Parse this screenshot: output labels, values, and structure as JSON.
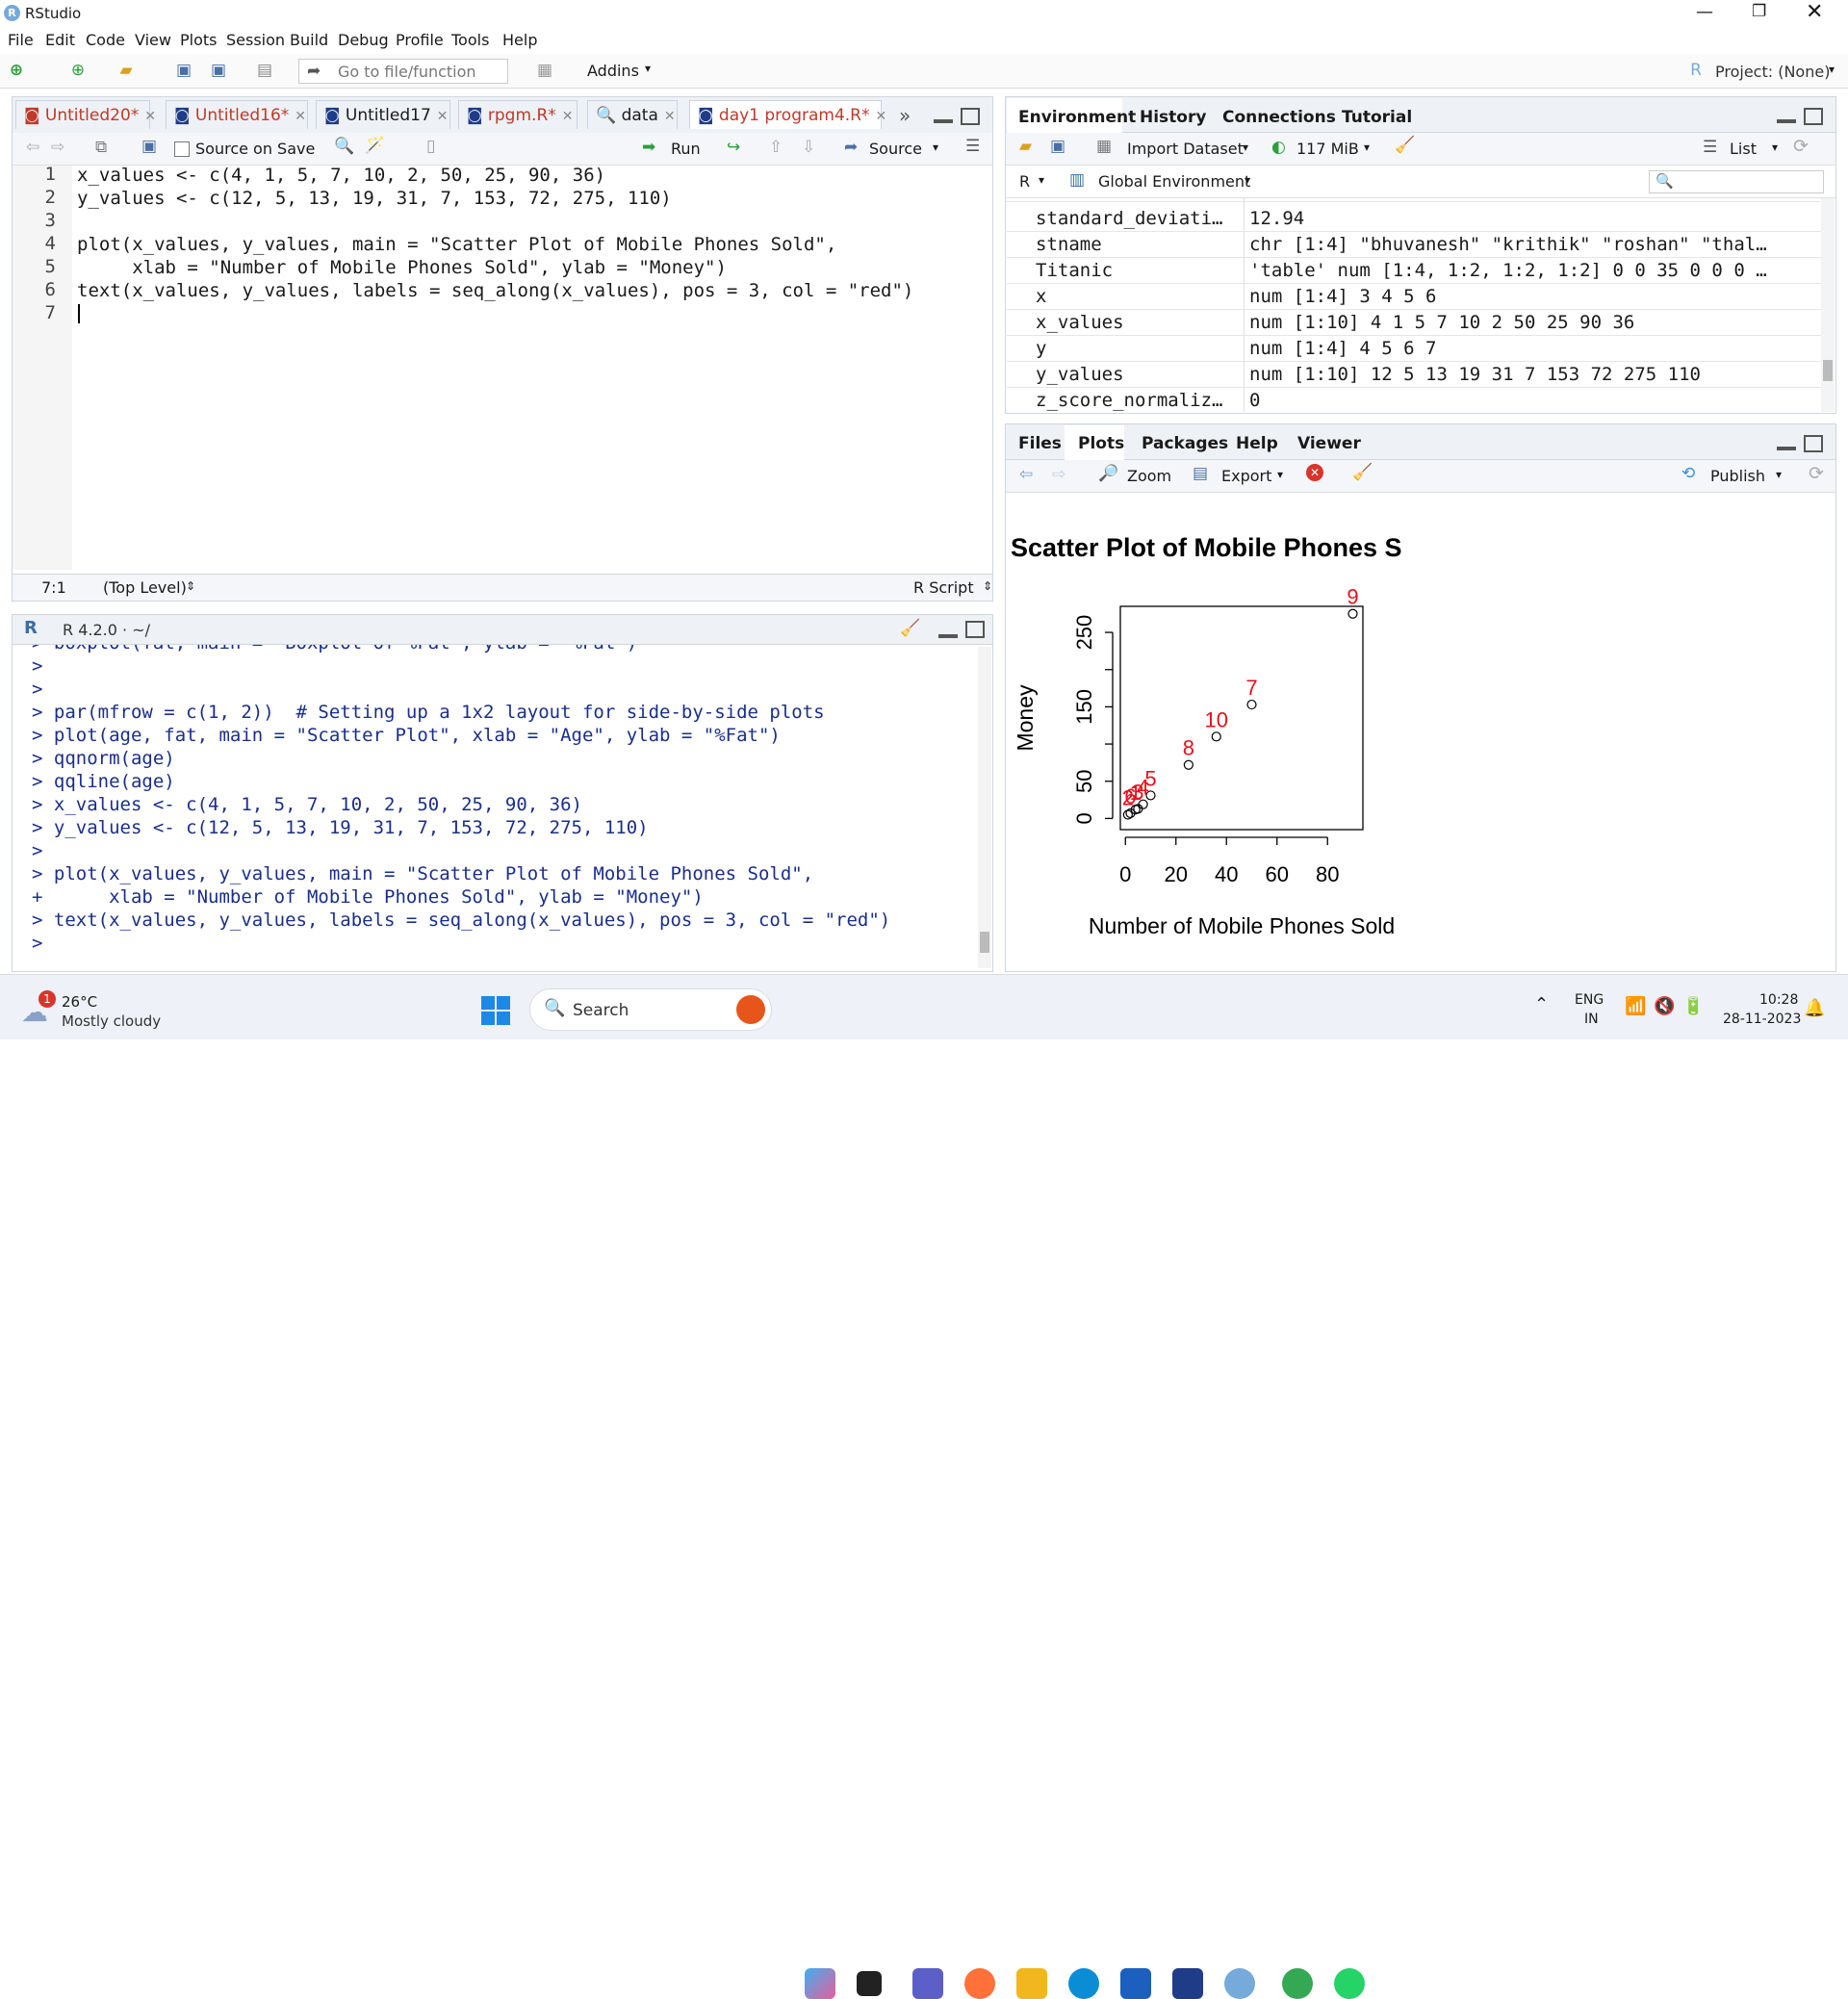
{
  "window": {
    "title": "RStudio",
    "app_icon": "R"
  },
  "menu": [
    "File",
    "Edit",
    "Code",
    "View",
    "Plots",
    "Session",
    "Build",
    "Debug",
    "Profile",
    "Tools",
    "Help"
  ],
  "toolbar": {
    "goto_placeholder": "Go to file/function",
    "addins": "Addins",
    "project": "Project: (None)"
  },
  "editor": {
    "tabs": [
      {
        "label": "Untitled20*",
        "modified": true
      },
      {
        "label": "Untitled16*",
        "modified": true
      },
      {
        "label": "Untitled17",
        "modified": false
      },
      {
        "label": "rpgm.R*",
        "modified": true
      },
      {
        "label": "data",
        "modified": false
      },
      {
        "label": "day1 program4.R*",
        "modified": true
      }
    ],
    "source_on_save": "Source on Save",
    "run": "Run",
    "source": "Source",
    "line_numbers": [
      "1",
      "2",
      "3",
      "4",
      "5",
      "6",
      "7"
    ],
    "lines": [
      "x_values <- c(4, 1, 5, 7, 10, 2, 50, 25, 90, 36)",
      "y_values <- c(12, 5, 13, 19, 31, 7, 153, 72, 275, 110)",
      "",
      "plot(x_values, y_values, main = \"Scatter Plot of Mobile Phones Sold\",",
      "     xlab = \"Number of Mobile Phones Sold\", ylab = \"Money\")",
      "text(x_values, y_values, labels = seq_along(x_values), pos = 3, col = \"red\")",
      ""
    ],
    "status_pos": "7:1",
    "status_scope": "(Top Level)",
    "status_type": "R Script"
  },
  "console": {
    "header": "R 4.2.0 · ~/",
    "lines": [
      "> boxplot(fat, main = \"Boxplot of %Fat\", ylab = \"%Fat\")",
      ">",
      ">",
      "> par(mfrow = c(1, 2))  # Setting up a 1x2 layout for side-by-side plots",
      "> plot(age, fat, main = \"Scatter Plot\", xlab = \"Age\", ylab = \"%Fat\")",
      "> qqnorm(age)",
      "> qqline(age)",
      "> x_values <- c(4, 1, 5, 7, 10, 2, 50, 25, 90, 36)",
      "> y_values <- c(12, 5, 13, 19, 31, 7, 153, 72, 275, 110)",
      ">",
      "> plot(x_values, y_values, main = \"Scatter Plot of Mobile Phones Sold\",",
      "+      xlab = \"Number of Mobile Phones Sold\", ylab = \"Money\")",
      "> text(x_values, y_values, labels = seq_along(x_values), pos = 3, col = \"red\")",
      "> "
    ]
  },
  "environment": {
    "tabs": [
      "Environment",
      "History",
      "Connections",
      "Tutorial"
    ],
    "import_dataset": "Import Dataset",
    "memory": "117 MiB",
    "list": "List",
    "lang": "R",
    "scope": "Global Environment",
    "rows": [
      {
        "name": "standard_deviati…",
        "value": "12.94"
      },
      {
        "name": "stname",
        "value": "chr [1:4] \"bhuvanesh\" \"krithik\" \"roshan\" \"thal…"
      },
      {
        "name": "Titanic",
        "value": "'table' num [1:4, 1:2, 1:2, 1:2] 0 0 35 0 0 0 …"
      },
      {
        "name": "x",
        "value": "num [1:4] 3 4 5 6"
      },
      {
        "name": "x_values",
        "value": "num [1:10] 4 1 5 7 10 2 50 25 90 36"
      },
      {
        "name": "y",
        "value": "num [1:4] 4 5 6 7"
      },
      {
        "name": "y_values",
        "value": "num [1:10] 12 5 13 19 31 7 153 72 275 110"
      },
      {
        "name": "z_score_normaliz…",
        "value": "0"
      }
    ]
  },
  "files": {
    "tabs": [
      "Files",
      "Plots",
      "Packages",
      "Help",
      "Viewer"
    ],
    "zoom": "Zoom",
    "export": "Export",
    "publish": "Publish"
  },
  "chart_data": {
    "type": "scatter",
    "title": "Scatter Plot of Mobile Phones S",
    "xlabel": "Number of Mobile Phones Sold",
    "ylabel": "Money",
    "x": [
      4,
      1,
      5,
      7,
      10,
      2,
      50,
      25,
      90,
      36
    ],
    "y": [
      12,
      5,
      13,
      19,
      31,
      7,
      153,
      72,
      275,
      110
    ],
    "point_labels": [
      "1",
      "2",
      "3",
      "4",
      "5",
      "6",
      "7",
      "8",
      "9",
      "10"
    ],
    "label_color": "#e8101c",
    "xticks": [
      0,
      20,
      40,
      60,
      80
    ],
    "yticks": [
      0,
      50,
      150,
      250
    ],
    "xlim": [
      -2,
      94
    ],
    "ylim": [
      -15,
      285
    ]
  },
  "taskbar": {
    "weather_temp": "26°C",
    "weather_desc": "Mostly cloudy",
    "weather_badge": "1",
    "search": "Search",
    "lang1": "ENG",
    "lang2": "IN",
    "time": "10:28",
    "date": "28-11-2023"
  }
}
